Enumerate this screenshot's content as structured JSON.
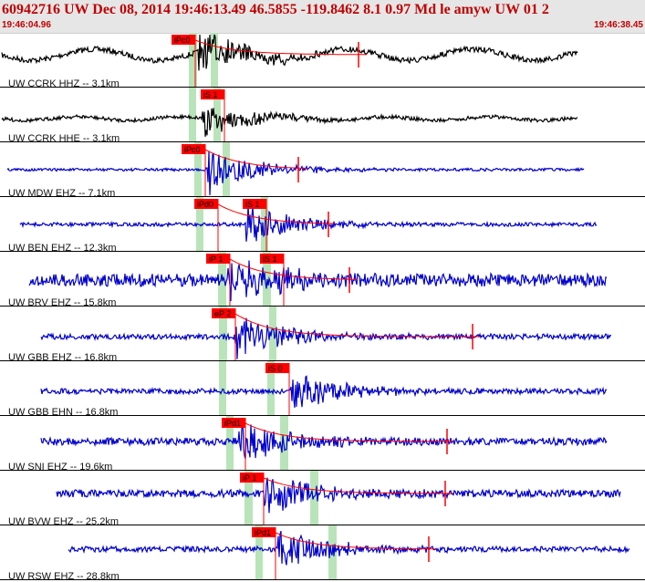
{
  "header": {
    "title": "60942716 UW Dec 08, 2014 19:46:13.49   46.5855 -119.8462  8.1 0.97 Md le amyw UW 01   2",
    "time_start": "19:46:04.96",
    "time_end": "19:46:38.45"
  },
  "colors": {
    "title": "#c00000",
    "trace_black": "#000000",
    "trace_blue": "#0000cc",
    "pick": "#ff0000",
    "pick_band": "#b9e4b9",
    "separator": "#000000"
  },
  "traces": [
    {
      "label": "UW CCRK HHZ -- 3.1km",
      "color": "black",
      "picks": [
        "iPc0"
      ]
    },
    {
      "label": "UW CCRK HHE -- 3.1km",
      "color": "black",
      "picks": [
        "iS 1"
      ]
    },
    {
      "label": "UW MDW EHZ -- 7.1km",
      "color": "blue",
      "picks": [
        "iPc0"
      ]
    },
    {
      "label": "UW BEN EHZ -- 12.3km",
      "color": "blue",
      "picks": [
        "iPd0",
        "iS 1"
      ]
    },
    {
      "label": "UW BRV EHZ -- 15.8km",
      "color": "blue",
      "picks": [
        "iP 1",
        "iS 1"
      ]
    },
    {
      "label": "UW GBB EHZ -- 16.8km",
      "color": "blue",
      "picks": [
        "eP 2"
      ]
    },
    {
      "label": "UW GBB EHN -- 16.8km",
      "color": "blue",
      "picks": [
        "iS 0"
      ]
    },
    {
      "label": "UW SNI EHZ -- 19.6km",
      "color": "blue",
      "picks": [
        "iPd1"
      ]
    },
    {
      "label": "UW BVW EHZ -- 25.2km",
      "color": "blue",
      "picks": [
        "iP 1"
      ]
    },
    {
      "label": "UW RSW EHZ -- 28.8km",
      "color": "blue",
      "picks": [
        "iPd1"
      ]
    }
  ]
}
